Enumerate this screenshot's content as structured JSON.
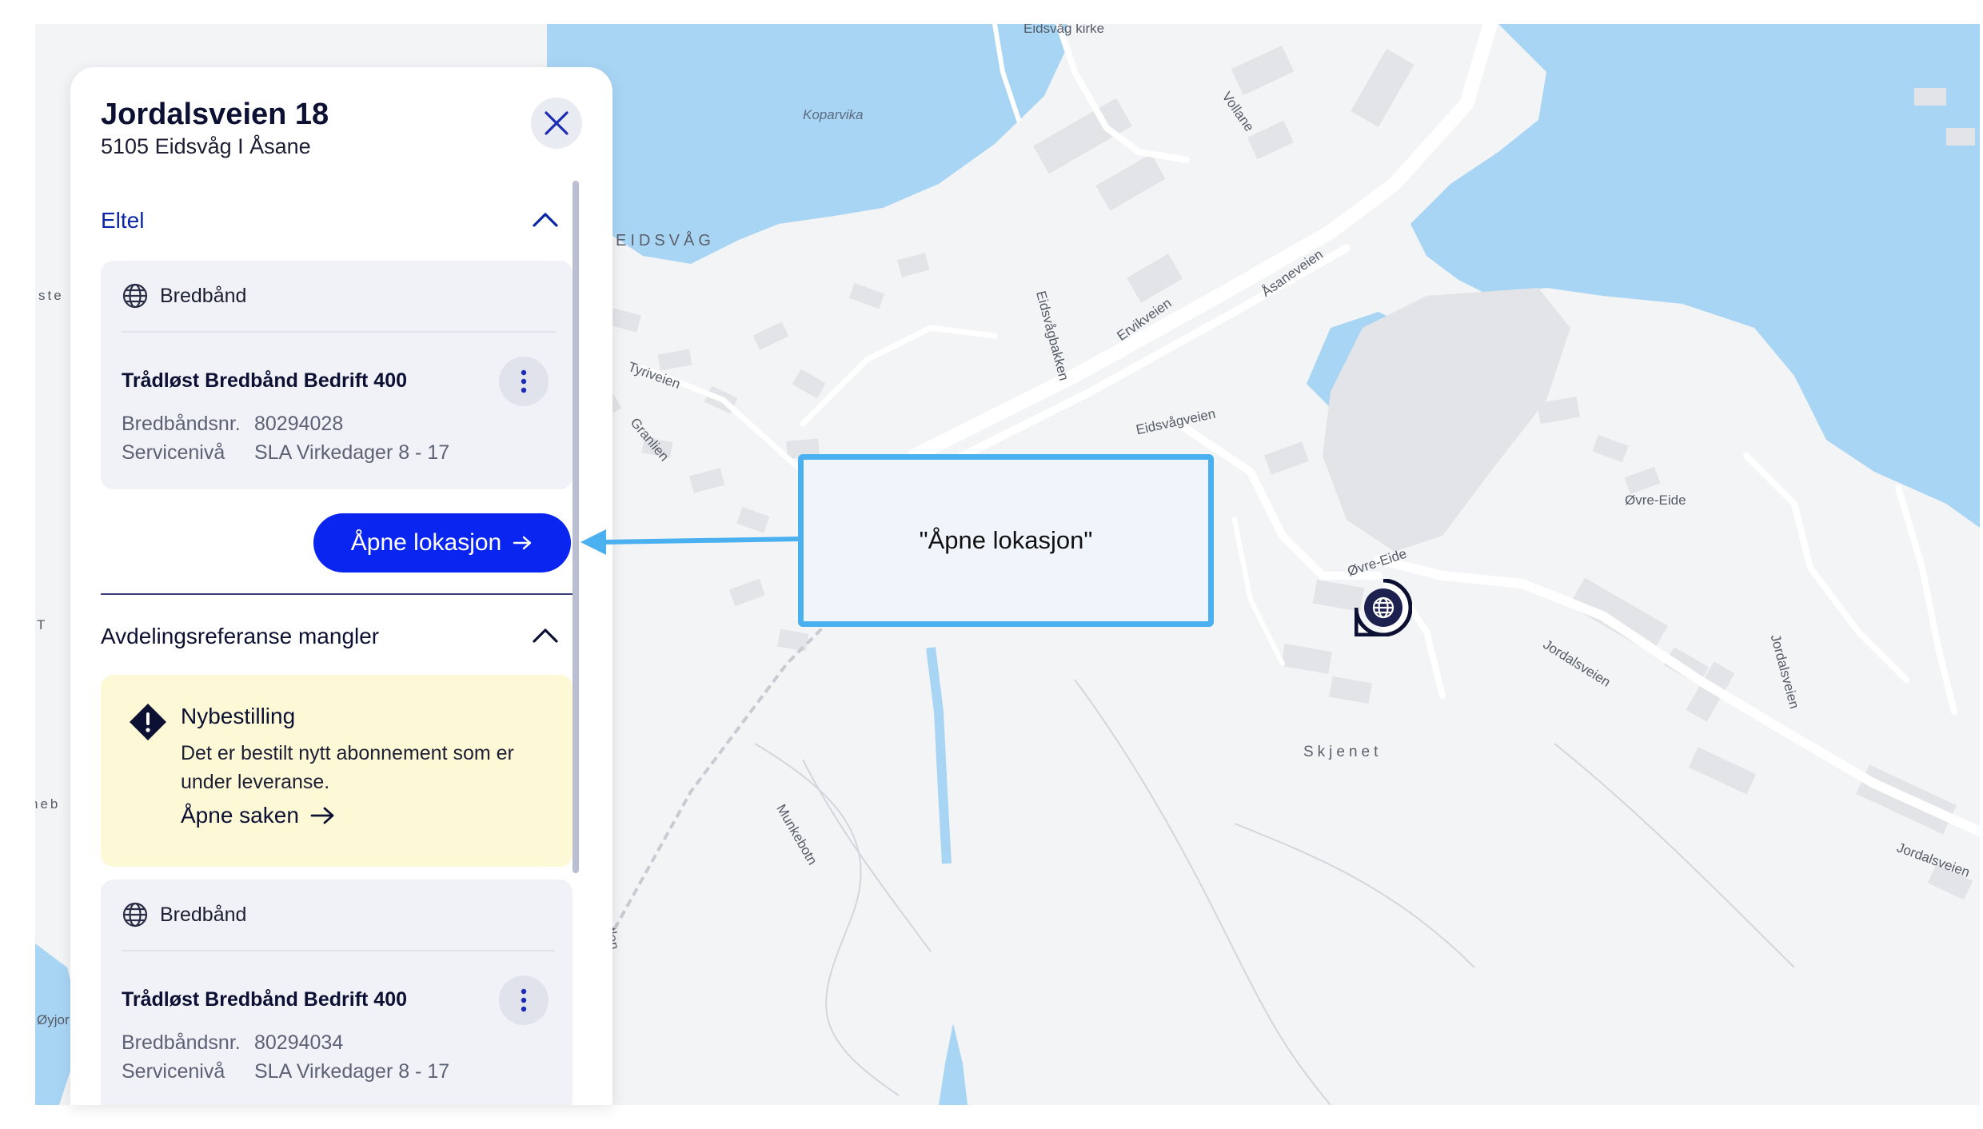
{
  "map": {
    "labels": {
      "eidsvag_kirke": "Eidsvåg kirke",
      "koparvika": "Koparvika",
      "eidsvag": "EIDSVÅG",
      "vollane": "Vollane",
      "asaneveien": "Åsaneveien",
      "ervikveien": "Ervikveien",
      "eidsvagbakken": "Eidsvågbakken",
      "tyriveien": "Tyriveien",
      "granlien": "Granlien",
      "eidsvagveien": "Eidsvågveien",
      "ovre_eide": "Øvre-Eide",
      "ovre_eide_road": "Øvre-Eide",
      "jordalsveien": "Jordalsveien",
      "jordalsveien_2": "Jordalsveien",
      "jordalsveien_3": "Jordalsveien",
      "skjenet": "Skjenet",
      "munkebotn": "Munkebotn",
      "oyjor": "Øyjor",
      "edge_ste": "ste",
      "edge_t": "T",
      "edge_neb": "neb",
      "edge_tlen": "tlen"
    },
    "marker_icon": "globe-icon"
  },
  "panel": {
    "title": "Jordalsveien 18",
    "subtitle": "5105 Eidsvåg I Åsane",
    "close_icon": "close-icon",
    "sections": [
      {
        "title": "Eltel",
        "title_color": "#0a25a8",
        "expanded": true,
        "card": {
          "type_label": "Bredbånd",
          "product": "Trådløst Bredbånd Bedrift 400",
          "fields": [
            {
              "key": "Bredbåndsnr.",
              "value": "80294028"
            },
            {
              "key": "Servicenivå",
              "value": "SLA Virkedager 8 - 17"
            }
          ]
        },
        "action_label": "Åpne lokasjon"
      },
      {
        "title": "Avdelingsreferanse mangler",
        "title_color": "#0c1033",
        "expanded": true,
        "alert": {
          "title": "Nybestilling",
          "body": "Det er bestilt nytt abonnement som er under leveranse.",
          "link": "Åpne saken"
        },
        "card": {
          "type_label": "Bredbånd",
          "product": "Trådløst Bredbånd Bedrift 400",
          "fields": [
            {
              "key": "Bredbåndsnr.",
              "value": "80294034"
            },
            {
              "key": "Servicenivå",
              "value": "SLA Virkedager 8 - 17"
            }
          ]
        }
      }
    ]
  },
  "callout": {
    "text": "\"Åpne lokasjon\""
  },
  "colors": {
    "primary_button": "#0a25f0",
    "callout_border": "#4ab0ef",
    "water": "#a9d5f5",
    "alert_background": "#fdf8d6"
  }
}
